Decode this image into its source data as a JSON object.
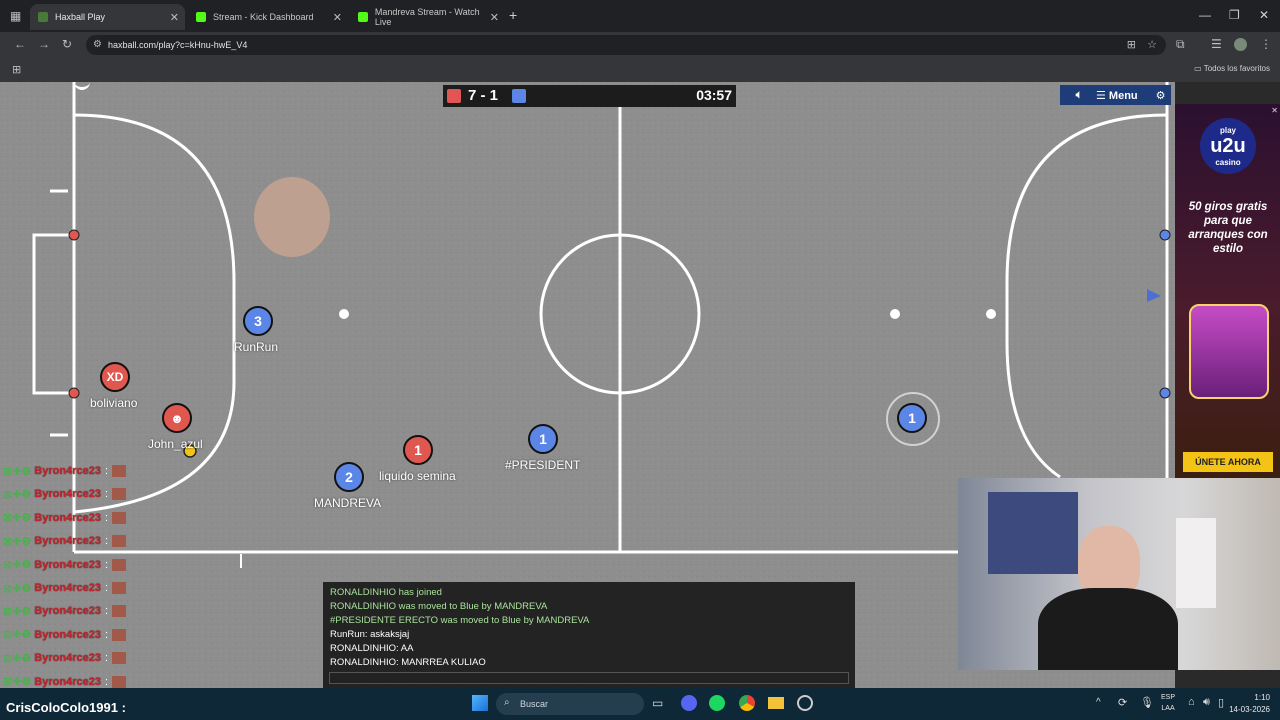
{
  "browser": {
    "tabs": [
      {
        "title": "Haxball Play",
        "active": true,
        "favicon_color": "#4a7a3a"
      },
      {
        "title": "Stream - Kick Dashboard",
        "active": false,
        "favicon_color": "#53fc18"
      },
      {
        "title": "Mandreva Stream - Watch Live",
        "active": false,
        "favicon_color": "#53fc18"
      }
    ],
    "new_tab": "+",
    "url": "haxball.com/play?c=kHnu-hwE_V4",
    "bookmarks_all": "Todos los favoritos"
  },
  "game": {
    "score": "7 - 1",
    "time": "03:57",
    "menu_label": "Menu",
    "players": [
      {
        "number": "3",
        "team": "blue",
        "name": "RunRun"
      },
      {
        "number": "XD",
        "team": "red",
        "name": "boliviano"
      },
      {
        "number": "",
        "team": "red",
        "name": "John_azul"
      },
      {
        "number": "2",
        "team": "blue",
        "name": "MANDREVA"
      },
      {
        "number": "1",
        "team": "red",
        "name": "liquido semina"
      },
      {
        "number": "1",
        "team": "blue",
        "name": "#PRESIDENT"
      },
      {
        "number": "1",
        "team": "blue",
        "name": ""
      }
    ]
  },
  "chat": {
    "lines": [
      {
        "text": "RONALDINHIO has joined",
        "color": "#a9e29b"
      },
      {
        "text": "RONALDINHIO was moved to Blue by MANDREVA",
        "color": "#a9e29b"
      },
      {
        "text": "#PRESIDENTE ERECTO was moved to Blue by MANDREVA",
        "color": "#a9e29b"
      },
      {
        "text": "RunRun: askaksjaj",
        "color": "#ffffff"
      },
      {
        "text": "RONALDINHIO: AA",
        "color": "#ffffff"
      },
      {
        "text": "RONALDINHIO: MANRREA KULIAO",
        "color": "#ffffff"
      }
    ]
  },
  "ad": {
    "brand_top": "play",
    "brand": "u2u",
    "brand_sub": "casino",
    "headline": "50 giros gratis para que arranques con estilo",
    "cta": "ÚNETE AHORA"
  },
  "overlay": {
    "killfeed_name": "Byron4rce23",
    "killfeed_count": 10,
    "streamer": "CrisColoColo1991 :"
  },
  "taskbar": {
    "search": "Buscar",
    "lang_top": "ESP",
    "lang_bottom": "LAA",
    "time": "1:10",
    "date": "14-03-2026"
  }
}
